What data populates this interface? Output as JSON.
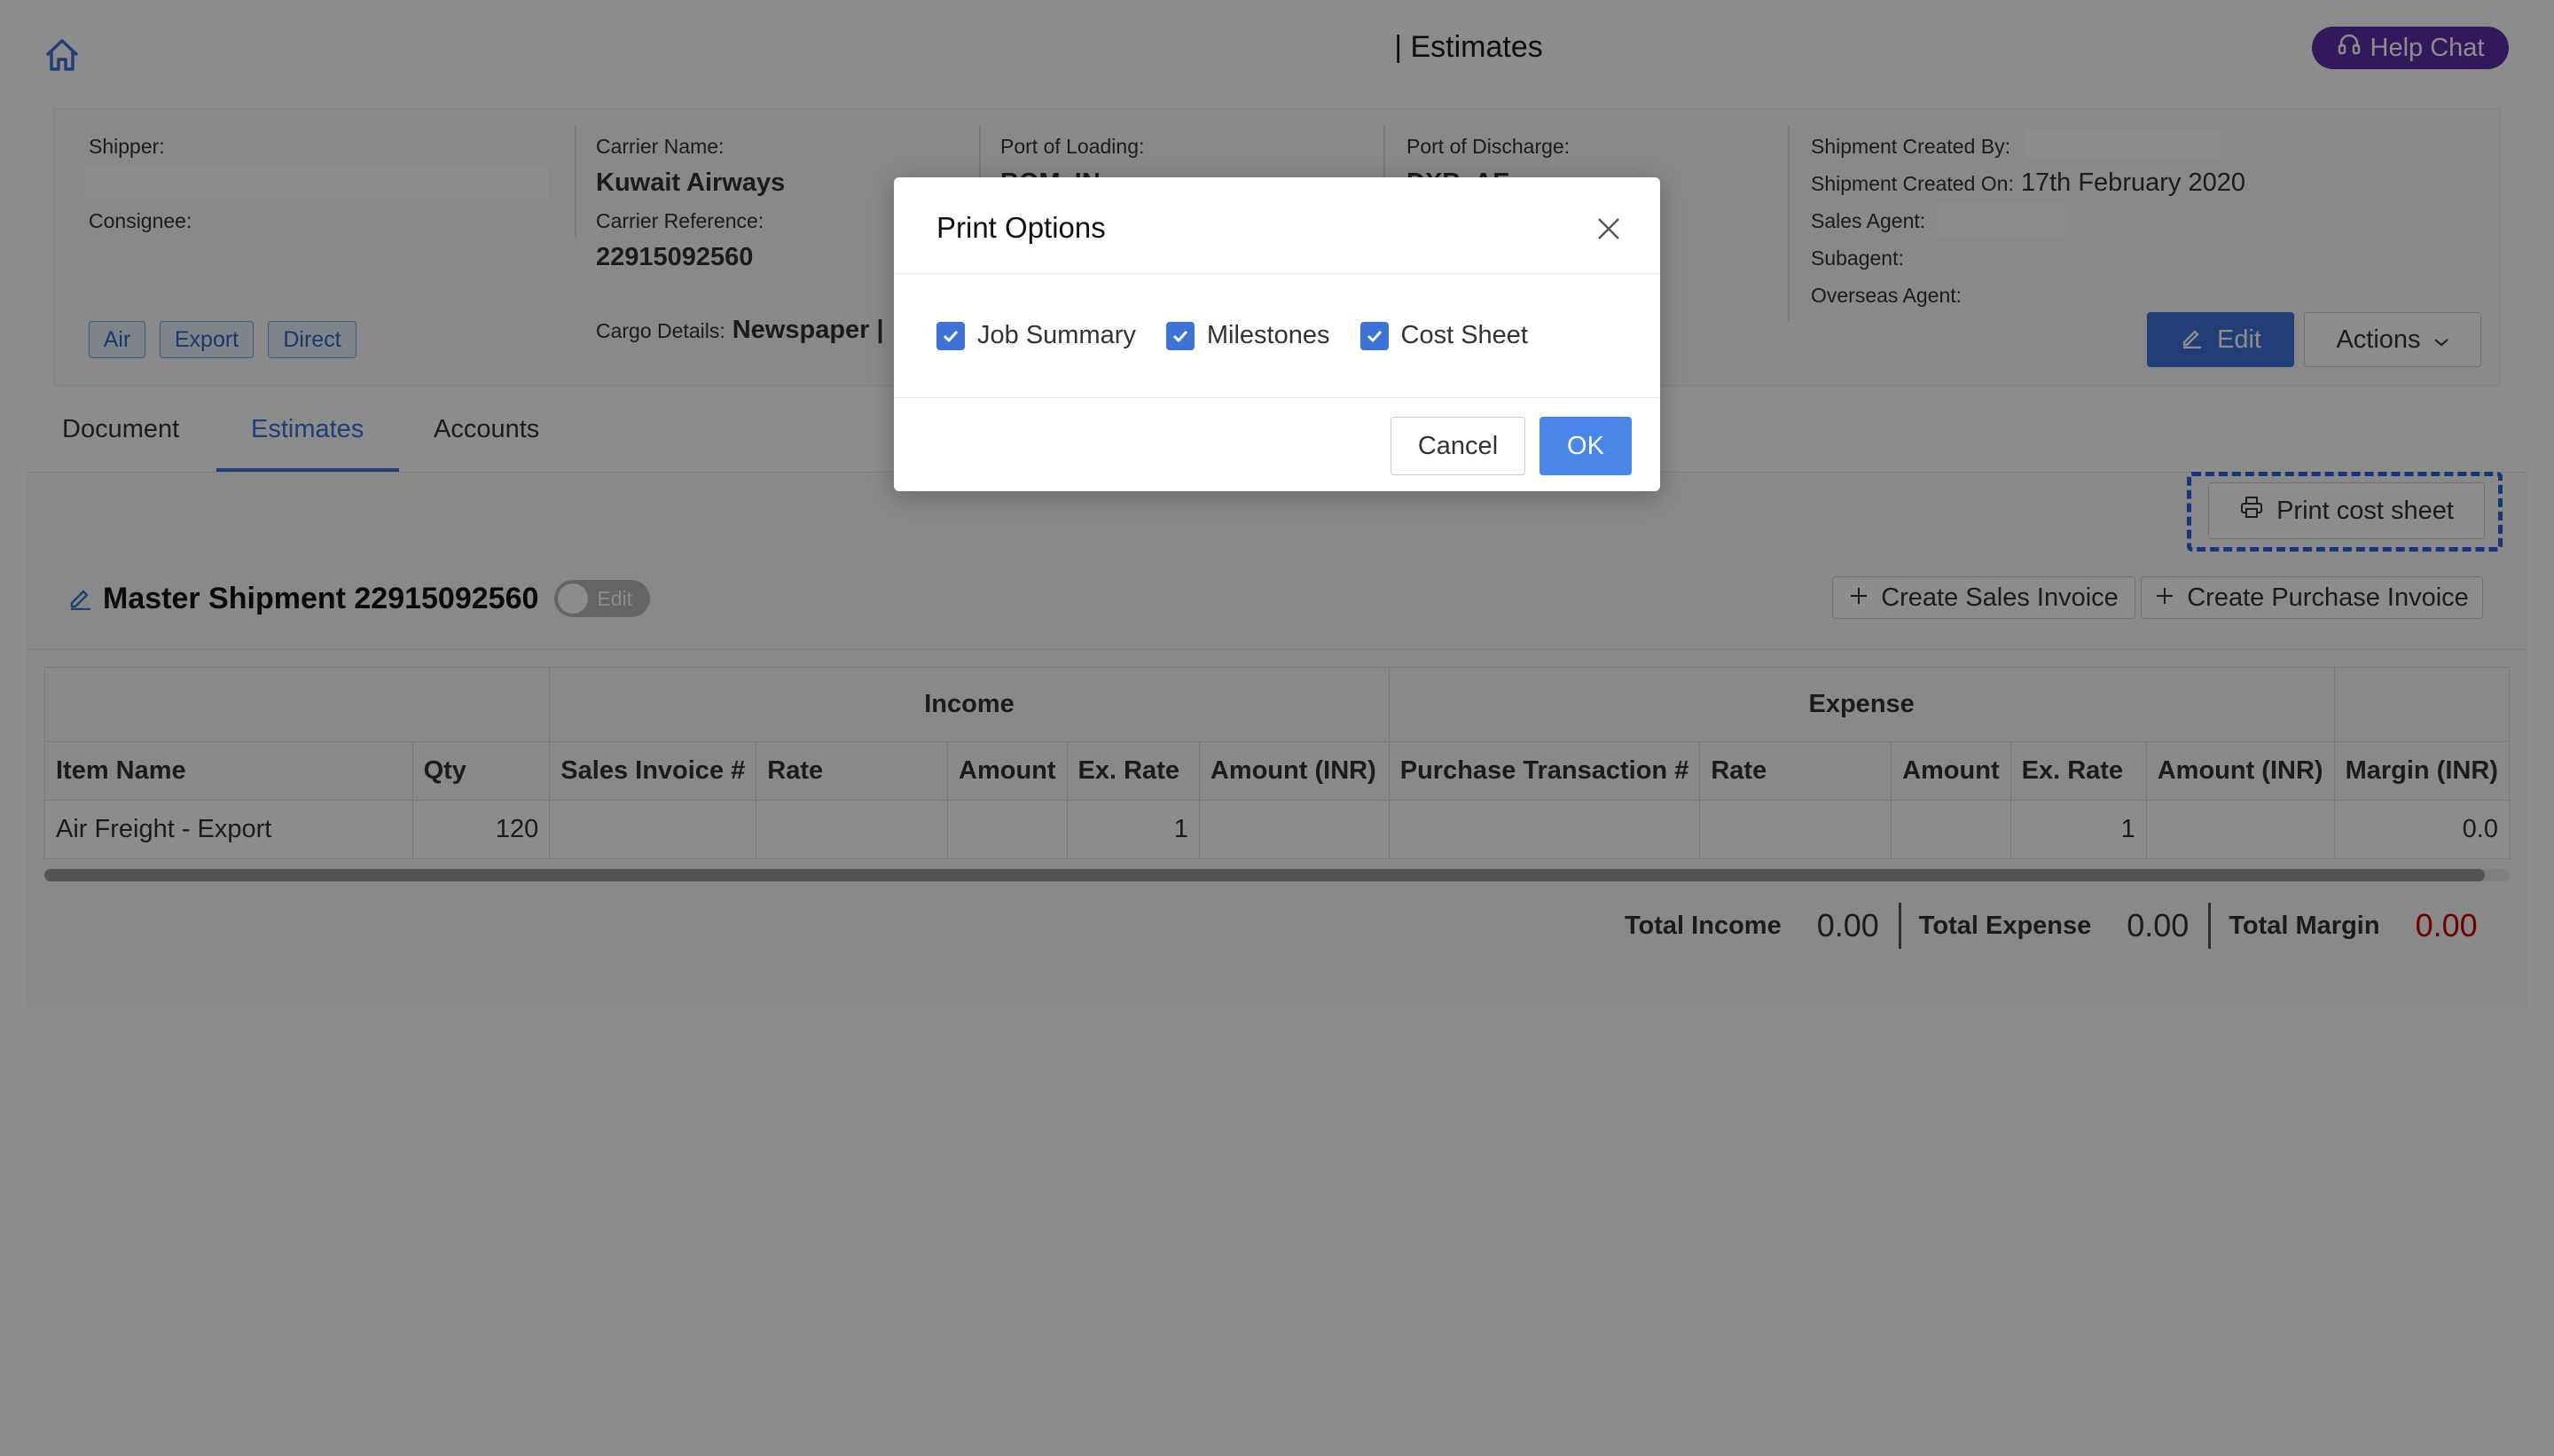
{
  "header": {
    "title_suffix": "| Estimates",
    "help_chat": "Help Chat"
  },
  "shipment": {
    "shipper_label": "Shipper:",
    "consignee_label": "Consignee:",
    "carrier_name_label": "Carrier Name:",
    "carrier_name": "Kuwait Airways",
    "carrier_reference_label": "Carrier Reference:",
    "carrier_reference": "22915092560",
    "cargo_details_label": "Cargo Details:",
    "cargo_details": "Newspaper |",
    "port_loading_label": "Port of Loading:",
    "port_loading": "BOM, IN",
    "port_discharge_label": "Port of Discharge:",
    "port_discharge": "DXB, AE",
    "created_by_label": "Shipment Created By:",
    "created_on_label": "Shipment Created On:",
    "created_on": "17th February 2020",
    "sales_agent_label": "Sales Agent:",
    "subagent_label": "Subagent:",
    "overseas_agent_label": "Overseas Agent:",
    "tags": [
      "Air",
      "Export",
      "Direct"
    ],
    "edit_button": "Edit",
    "actions_button": "Actions"
  },
  "tabs": [
    {
      "label": "Document",
      "active": false
    },
    {
      "label": "Estimates",
      "active": true
    },
    {
      "label": "Accounts",
      "active": false
    }
  ],
  "estimates": {
    "print_cost_sheet": "Print cost sheet",
    "master_shipment_title": "Master Shipment 22915092560",
    "toggle_label": "Edit",
    "create_sales_invoice": "Create Sales Invoice",
    "create_purchase_invoice": "Create Purchase Invoice",
    "group_headers": {
      "income": "Income",
      "expense": "Expense"
    },
    "columns": [
      "Item Name",
      "Qty",
      "Sales Invoice #",
      "Rate",
      "Amount",
      "Ex. Rate",
      "Amount (INR)",
      "Purchase Transaction #",
      "Rate",
      "Amount",
      "Ex. Rate",
      "Amount (INR)",
      "Margin (INR)"
    ],
    "rows": [
      [
        "Air Freight - Export",
        "120",
        "",
        "",
        "",
        "1",
        "",
        "",
        "",
        "",
        "1",
        "",
        "0.0"
      ]
    ],
    "totals": {
      "income_label": "Total Income",
      "income_value": "0.00",
      "expense_label": "Total Expense",
      "expense_value": "0.00",
      "margin_label": "Total Margin",
      "margin_value": "0.00"
    }
  },
  "modal": {
    "title": "Print Options",
    "options": [
      {
        "label": "Job Summary",
        "checked": true
      },
      {
        "label": "Milestones",
        "checked": true
      },
      {
        "label": "Cost Sheet",
        "checked": true
      }
    ],
    "cancel": "Cancel",
    "ok": "OK"
  },
  "colors": {
    "primary": "#3d72d8",
    "help_chat": "#5b2ea6",
    "margin_negative": "#c00000",
    "focus_outline": "#2f5fe0"
  },
  "icons": [
    "home-icon",
    "headset-icon",
    "pencil-icon",
    "chevron-down-icon",
    "printer-icon",
    "plus-icon",
    "close-icon",
    "checkmark-icon"
  ]
}
